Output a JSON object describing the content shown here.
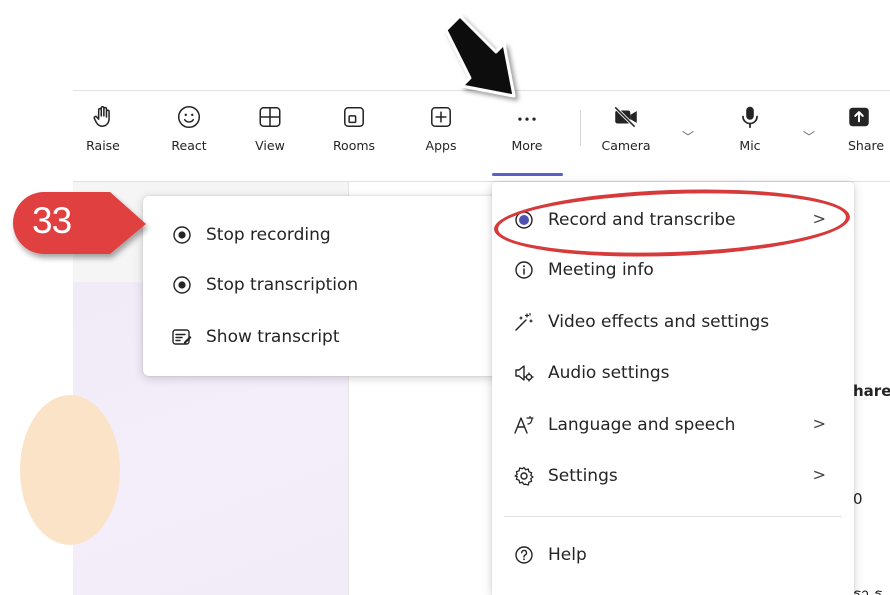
{
  "toolbar": {
    "buttons": [
      {
        "label": "Raise",
        "icon": "hand-icon"
      },
      {
        "label": "React",
        "icon": "smiley-icon"
      },
      {
        "label": "View",
        "icon": "grid-icon"
      },
      {
        "label": "Rooms",
        "icon": "rooms-icon"
      },
      {
        "label": "Apps",
        "icon": "add-app-icon"
      },
      {
        "label": "More",
        "icon": "ellipsis-icon"
      },
      {
        "label": "Camera",
        "icon": "camera-off-icon"
      },
      {
        "label": "Mic",
        "icon": "mic-icon"
      },
      {
        "label": "Share",
        "icon": "share-icon"
      }
    ]
  },
  "submenu": {
    "items": [
      {
        "label": "Stop recording",
        "icon": "stop-record-icon"
      },
      {
        "label": "Stop transcription",
        "icon": "stop-record-icon"
      },
      {
        "label": "Show transcript",
        "icon": "transcript-icon"
      }
    ]
  },
  "menu": {
    "items": [
      {
        "label": "Record and transcribe",
        "icon": "record-icon",
        "has_submenu": true
      },
      {
        "label": "Meeting info",
        "icon": "info-icon",
        "has_submenu": false
      },
      {
        "label": "Video effects and settings",
        "icon": "video-effects-icon",
        "has_submenu": false
      },
      {
        "label": "Audio settings",
        "icon": "speaker-settings-icon",
        "has_submenu": false
      },
      {
        "label": "Language and speech",
        "icon": "language-icon",
        "has_submenu": true
      },
      {
        "label": "Settings",
        "icon": "gear-icon",
        "has_submenu": true
      },
      {
        "label": "Help",
        "icon": "help-icon",
        "has_submenu": false
      }
    ],
    "submenu_arrow": ">"
  },
  "annotation": {
    "step_number": "33",
    "badge_color": "#e0403f",
    "highlight_color": "#d63a3a"
  },
  "background": {
    "right_fragments": [
      "hare",
      "0",
      "รา ร"
    ]
  },
  "colors": {
    "accent": "#5b5fc7"
  }
}
